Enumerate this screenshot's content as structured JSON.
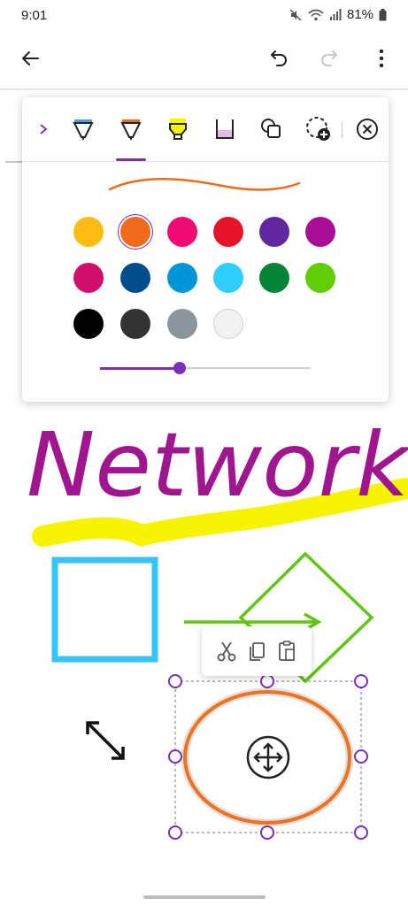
{
  "status": {
    "time": "9:01",
    "battery": "81%"
  },
  "appbar": {
    "icons": [
      "back-arrow-icon",
      "undo-icon",
      "redo-icon",
      "more-vert-icon"
    ]
  },
  "palette": {
    "tools": [
      "chevron-right-icon",
      "pen-icon",
      "pen-icon",
      "highlighter-icon",
      "ink-to-shape-icon",
      "shapes-icon",
      "lasso-select-icon",
      "close-circle-icon"
    ],
    "selected_tool_index": 1,
    "selected_color": "#f26a1b",
    "slider_fraction": 0.38,
    "colors": [
      [
        "#fbbd14",
        "#f26a1b",
        "#f10a74",
        "#e5142a",
        "#6127a1",
        "#a80e95"
      ],
      [
        "#cf0f6b",
        "#014d8b",
        "#0095d6",
        "#30ceff",
        "#048437",
        "#60cd07"
      ],
      [
        "#000000",
        "#333333",
        "#8a959c",
        "#f2f2f2"
      ]
    ]
  },
  "canvas": {
    "text": "Network",
    "text_color": "#a0168f",
    "highlight_color": "#f7f400",
    "rect_color": "#34c4f7",
    "diamond_color": "#60c513",
    "ellipse_color": "#f2711c"
  },
  "context_menu": {
    "icons": [
      "cut-icon",
      "copy-icon",
      "paste-icon"
    ]
  }
}
